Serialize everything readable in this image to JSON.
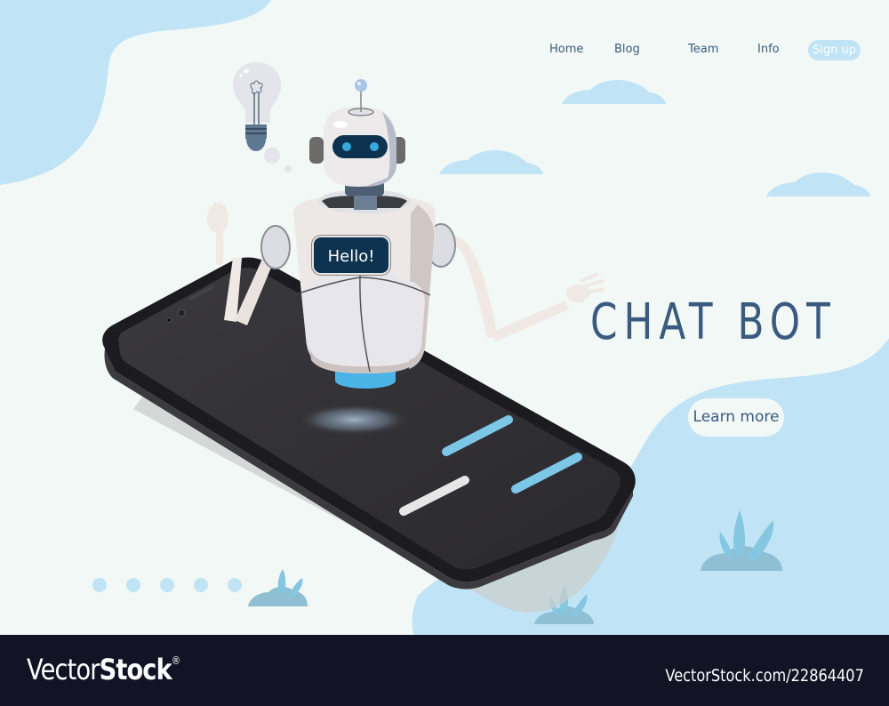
{
  "nav": {
    "links": [
      "Home",
      "Blog",
      "Team",
      "Info"
    ],
    "signup_label": "Sign up"
  },
  "hero": {
    "title": "CHAT BOT",
    "cta_label": "Learn more",
    "robot_speech": "Hello!",
    "pagination_dots": 5
  },
  "footer": {
    "logo_light": "Vector",
    "logo_bold": "Stock",
    "logo_mark": "®",
    "image_id": "VectorStock.com/22864407"
  },
  "colors": {
    "background": "#f2f8f5",
    "accent_blue": "#c0e4f6",
    "text_navy": "#3a5a80",
    "speech_bubble": "#0d3350",
    "phone_screen": "#2e2d31",
    "chat_bar_blue": "#7cc6e8",
    "footer_bg": "#121425"
  }
}
